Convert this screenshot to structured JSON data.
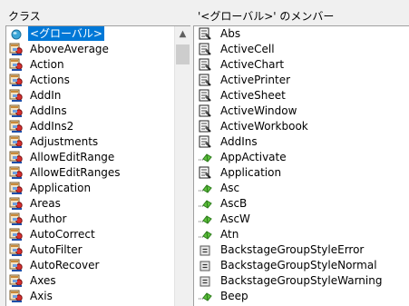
{
  "classes_pane": {
    "header": "クラス",
    "items": [
      {
        "label": "<グローバル>",
        "icon": "globe-icon",
        "selected": true
      },
      {
        "label": "AboveAverage",
        "icon": "class-icon"
      },
      {
        "label": "Action",
        "icon": "class-icon"
      },
      {
        "label": "Actions",
        "icon": "class-icon"
      },
      {
        "label": "AddIn",
        "icon": "class-icon"
      },
      {
        "label": "AddIns",
        "icon": "class-icon"
      },
      {
        "label": "AddIns2",
        "icon": "class-icon"
      },
      {
        "label": "Adjustments",
        "icon": "class-icon"
      },
      {
        "label": "AllowEditRange",
        "icon": "class-icon"
      },
      {
        "label": "AllowEditRanges",
        "icon": "class-icon"
      },
      {
        "label": "Application",
        "icon": "class-icon"
      },
      {
        "label": "Areas",
        "icon": "class-icon"
      },
      {
        "label": "Author",
        "icon": "class-icon"
      },
      {
        "label": "AutoCorrect",
        "icon": "class-icon"
      },
      {
        "label": "AutoFilter",
        "icon": "class-icon"
      },
      {
        "label": "AutoRecover",
        "icon": "class-icon"
      },
      {
        "label": "Axes",
        "icon": "class-icon"
      },
      {
        "label": "Axis",
        "icon": "class-icon"
      }
    ]
  },
  "members_pane": {
    "header": "'<グローバル>' のメンバー",
    "items": [
      {
        "label": "Abs",
        "icon": "property-icon"
      },
      {
        "label": "ActiveCell",
        "icon": "property-icon"
      },
      {
        "label": "ActiveChart",
        "icon": "property-icon"
      },
      {
        "label": "ActivePrinter",
        "icon": "property-icon"
      },
      {
        "label": "ActiveSheet",
        "icon": "property-icon"
      },
      {
        "label": "ActiveWindow",
        "icon": "property-icon"
      },
      {
        "label": "ActiveWorkbook",
        "icon": "property-icon"
      },
      {
        "label": "AddIns",
        "icon": "property-icon"
      },
      {
        "label": "AppActivate",
        "icon": "method-icon"
      },
      {
        "label": "Application",
        "icon": "property-icon"
      },
      {
        "label": "Asc",
        "icon": "method-icon"
      },
      {
        "label": "AscB",
        "icon": "method-icon"
      },
      {
        "label": "AscW",
        "icon": "method-icon"
      },
      {
        "label": "Atn",
        "icon": "method-icon"
      },
      {
        "label": "BackstageGroupStyleError",
        "icon": "constant-icon"
      },
      {
        "label": "BackstageGroupStyleNormal",
        "icon": "constant-icon"
      },
      {
        "label": "BackstageGroupStyleWarning",
        "icon": "constant-icon"
      },
      {
        "label": "Beep",
        "icon": "method-icon"
      }
    ]
  },
  "scrollbar": {
    "up_arrow": "▲"
  }
}
